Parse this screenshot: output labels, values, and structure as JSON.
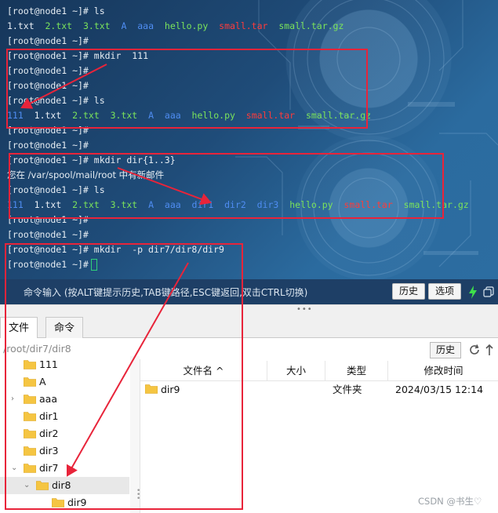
{
  "terminal": {
    "prompt": "[root@node1 ~]#",
    "lines": [
      {
        "type": "prompt",
        "cmd": "ls"
      },
      {
        "type": "files",
        "tokens": [
          {
            "t": "1.txt",
            "c": "white"
          },
          {
            "t": "2.txt",
            "c": "green"
          },
          {
            "t": "3.txt",
            "c": "green"
          },
          {
            "t": "A",
            "c": "blue"
          },
          {
            "t": "aaa",
            "c": "blue"
          },
          {
            "t": "hello.py",
            "c": "green"
          },
          {
            "t": "small.tar",
            "c": "red"
          },
          {
            "t": "small.tar.gz",
            "c": "green"
          }
        ]
      },
      {
        "type": "prompt",
        "cmd": ""
      },
      {
        "type": "prompt",
        "cmd": "mkdir  111"
      },
      {
        "type": "prompt",
        "cmd": ""
      },
      {
        "type": "prompt",
        "cmd": ""
      },
      {
        "type": "prompt",
        "cmd": "ls"
      },
      {
        "type": "files",
        "tokens": [
          {
            "t": "111",
            "c": "blue"
          },
          {
            "t": "1.txt",
            "c": "white"
          },
          {
            "t": "2.txt",
            "c": "green"
          },
          {
            "t": "3.txt",
            "c": "green"
          },
          {
            "t": "A",
            "c": "blue"
          },
          {
            "t": "aaa",
            "c": "blue"
          },
          {
            "t": "hello.py",
            "c": "green"
          },
          {
            "t": "small.tar",
            "c": "red"
          },
          {
            "t": "small.tar.gz",
            "c": "green"
          }
        ]
      },
      {
        "type": "prompt",
        "cmd": ""
      },
      {
        "type": "prompt",
        "cmd": ""
      },
      {
        "type": "prompt",
        "cmd": "mkdir dir{1..3}"
      },
      {
        "type": "text",
        "text": "您在 /var/spool/mail/root 中有新邮件"
      },
      {
        "type": "prompt",
        "cmd": "ls"
      },
      {
        "type": "files",
        "tokens": [
          {
            "t": "111",
            "c": "blue"
          },
          {
            "t": "1.txt",
            "c": "white"
          },
          {
            "t": "2.txt",
            "c": "green"
          },
          {
            "t": "3.txt",
            "c": "green"
          },
          {
            "t": "A",
            "c": "blue"
          },
          {
            "t": "aaa",
            "c": "blue"
          },
          {
            "t": "dir1",
            "c": "blue"
          },
          {
            "t": "dir2",
            "c": "blue"
          },
          {
            "t": "dir3",
            "c": "blue"
          },
          {
            "t": "hello.py",
            "c": "green"
          },
          {
            "t": "small.tar",
            "c": "red"
          },
          {
            "t": "small.tar.gz",
            "c": "green"
          }
        ]
      },
      {
        "type": "prompt",
        "cmd": ""
      },
      {
        "type": "prompt",
        "cmd": ""
      },
      {
        "type": "prompt",
        "cmd": "mkdir  -p dir7/dir8/dir9"
      },
      {
        "type": "prompt",
        "cmd": "",
        "cursor": true
      }
    ]
  },
  "cmdbar": {
    "hint": "命令输入 (按ALT键提示历史,TAB键路径,ESC键返回,双击CTRL切换)",
    "history_label": "历史",
    "options_label": "选项"
  },
  "tabs": {
    "files_label": "文件",
    "commands_label": "命令"
  },
  "pathbar": {
    "path": "/root/dir7/dir8",
    "history_label": "历史"
  },
  "tree": {
    "items": [
      {
        "label": "111",
        "level": 1,
        "expander": ""
      },
      {
        "label": "A",
        "level": 1,
        "expander": ""
      },
      {
        "label": "aaa",
        "level": 1,
        "expander": "›"
      },
      {
        "label": "dir1",
        "level": 1,
        "expander": ""
      },
      {
        "label": "dir2",
        "level": 1,
        "expander": ""
      },
      {
        "label": "dir3",
        "level": 1,
        "expander": ""
      },
      {
        "label": "dir7",
        "level": 1,
        "expander": "⌄"
      },
      {
        "label": "dir8",
        "level": 2,
        "expander": "⌄",
        "selected": true
      },
      {
        "label": "dir9",
        "level": 3,
        "expander": ""
      }
    ]
  },
  "filelist": {
    "columns": [
      "文件名 ^",
      "大小",
      "类型",
      "修改时间"
    ],
    "rows": [
      {
        "name": "dir9",
        "size": "",
        "type": "文件夹",
        "mtime": "2024/03/15 12:14"
      }
    ]
  },
  "watermark": "CSDN @书生♡",
  "colors": {
    "terminal_bg": "#1f4c79",
    "annotation_red": "#e8243a",
    "folder_yellow": "#f5c542",
    "cursor_green": "#2fd17a"
  }
}
